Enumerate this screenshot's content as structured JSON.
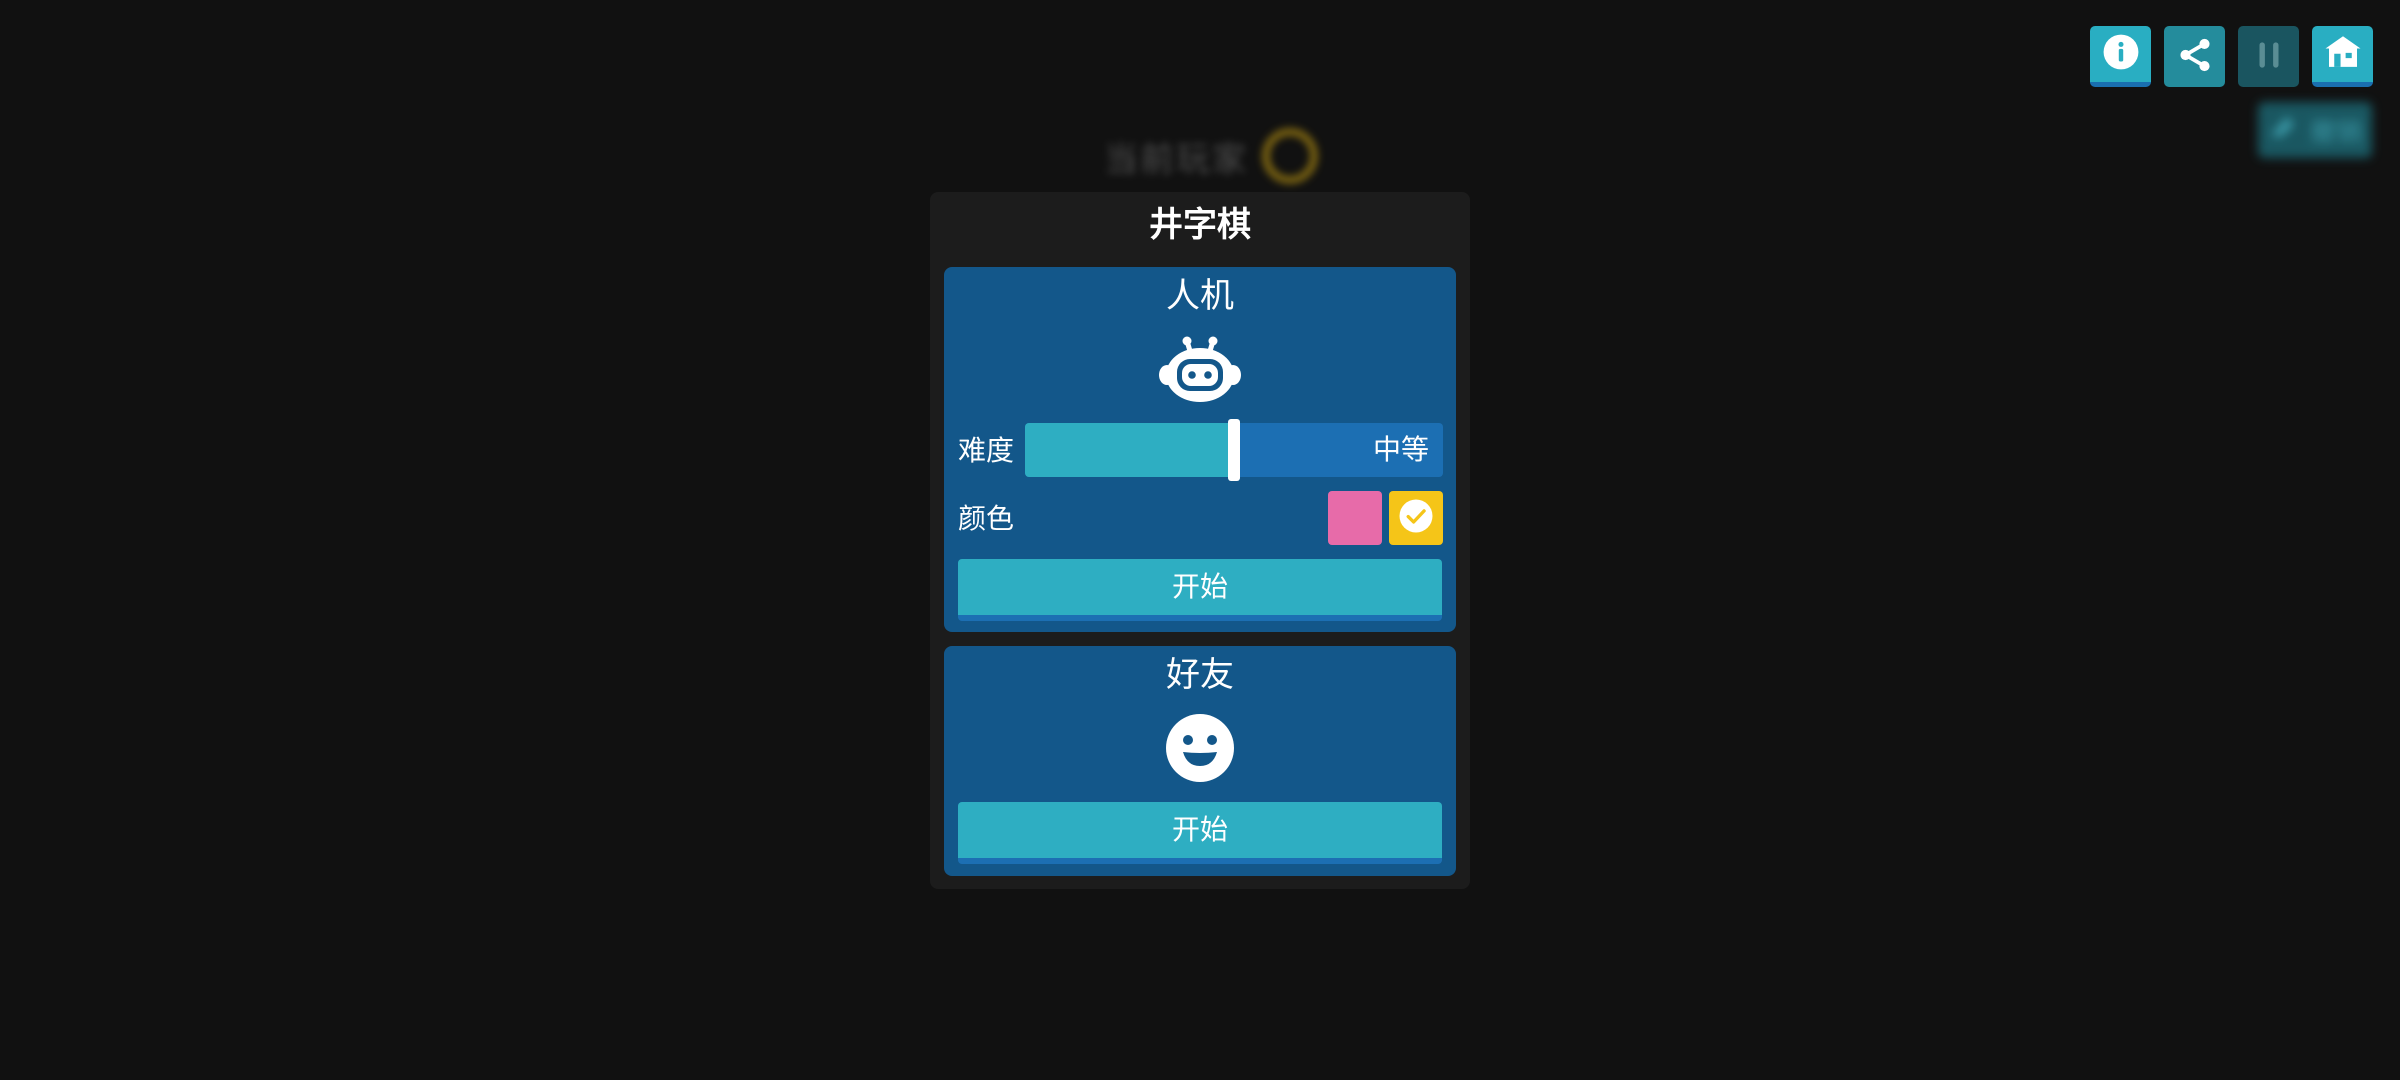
{
  "background": {
    "current_player_label": "当前玩家",
    "current_player_color": "#f5c518",
    "undo_label": "撤销"
  },
  "toolbar": {
    "buttons": [
      {
        "name": "info",
        "icon": "info-icon"
      },
      {
        "name": "share",
        "icon": "share-icon"
      },
      {
        "name": "pause",
        "icon": "pause-icon"
      },
      {
        "name": "home",
        "icon": "home-icon"
      }
    ]
  },
  "modal": {
    "title": "井字棋",
    "ai_mode": {
      "title": "人机",
      "icon": "robot-icon",
      "difficulty_label": "难度",
      "difficulty_value": "中等",
      "difficulty_level": 0.5,
      "color_label": "颜色",
      "colors": [
        {
          "name": "pink",
          "hex": "#e76ba9",
          "selected": false
        },
        {
          "name": "yellow",
          "hex": "#f5c518",
          "selected": true
        }
      ],
      "start_label": "开始"
    },
    "friend_mode": {
      "title": "好友",
      "icon": "smiley-icon",
      "start_label": "开始"
    }
  },
  "colors": {
    "background": "#111111",
    "modal": "#1c1c1c",
    "card": "#13578a",
    "accent": "#2eaec2",
    "accent_dark": "#1c6fb3"
  }
}
